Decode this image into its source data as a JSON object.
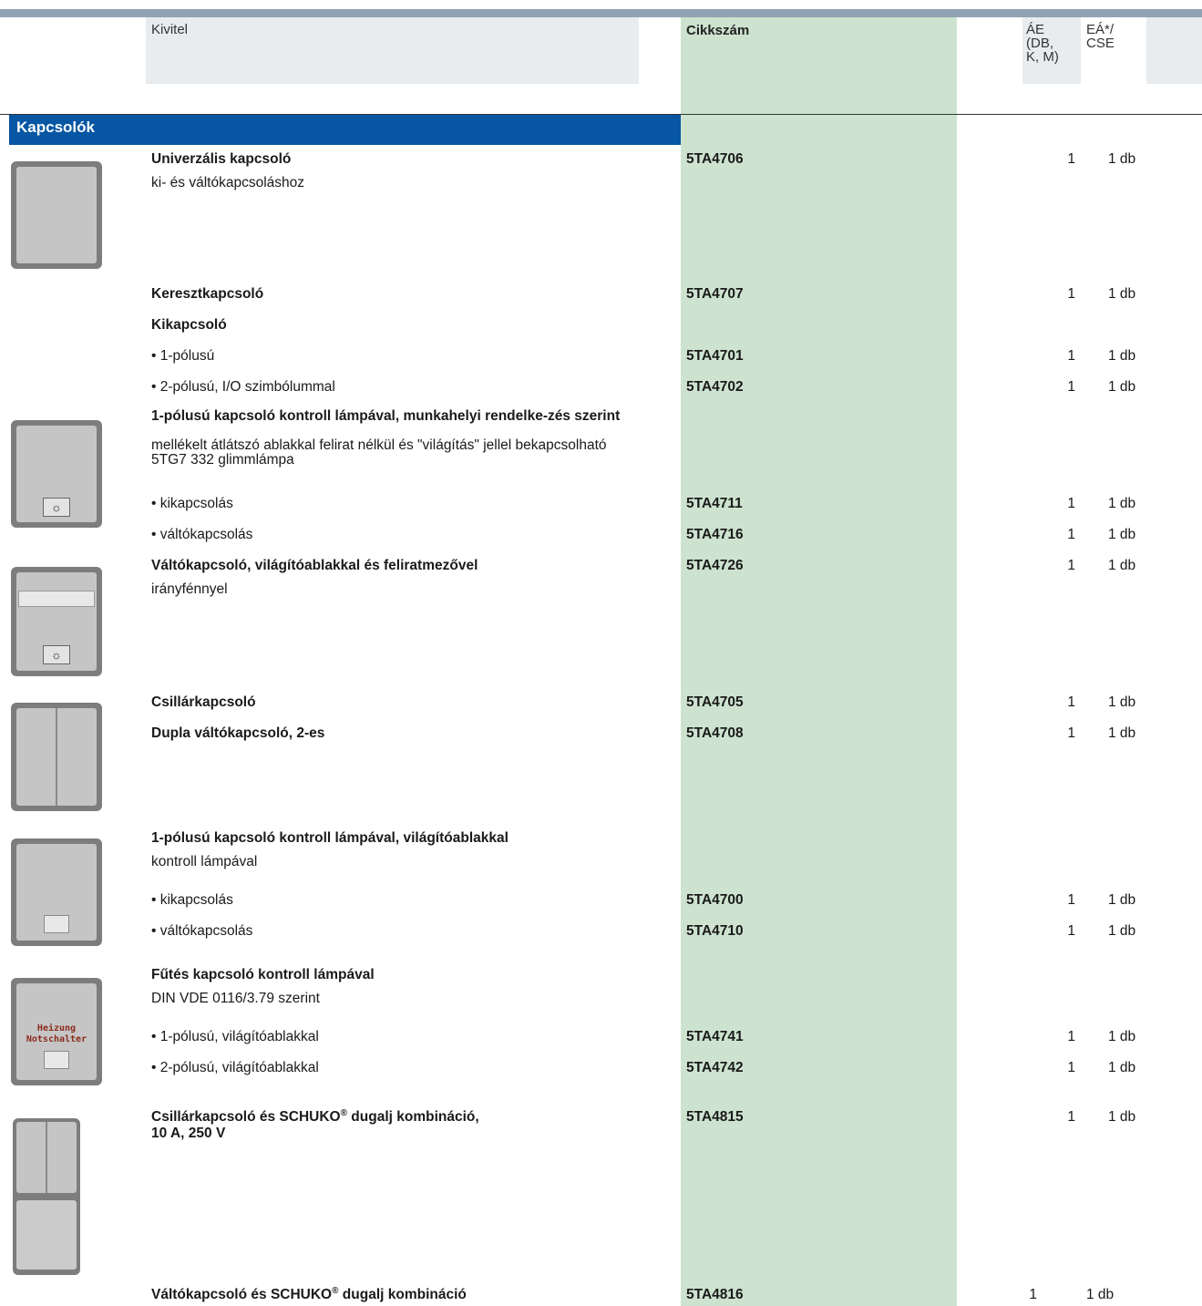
{
  "header": {
    "kivitel": "Kivitel",
    "cikkszam": "Cikkszám",
    "ae_lines": [
      "ÁE",
      "(DB,",
      "K, M)"
    ],
    "ea_lines": [
      "EÁ*/",
      "CSE"
    ]
  },
  "section_title": "Kapcsolók",
  "rows": [
    {
      "title": "Univerzális kapcsoló",
      "desc": "ki- és váltókapcsoláshoz",
      "code": "5TA4706",
      "ae": "1",
      "ea": "1 db"
    },
    {
      "title": "Keresztkapcsoló",
      "code": "5TA4707",
      "ae": "1",
      "ea": "1 db"
    },
    {
      "title": "Kikapcsoló"
    },
    {
      "text": "• 1-pólusú",
      "code": "5TA4701",
      "ae": "1",
      "ea": "1 db"
    },
    {
      "text": "• 2-pólusú, I/O szimbólummal",
      "code": "5TA4702",
      "ae": "1",
      "ea": "1 db"
    },
    {
      "title": "1-pólusú kapcsoló kontroll lámpával, munkahelyi rendelke-zés szerint",
      "desc": "mellékelt átlátszó ablakkal felirat nélkül és \"világítás\" jellel bekapcsolható 5TG7 332 glimmlámpa"
    },
    {
      "text": "• kikapcsolás",
      "code": "5TA4711",
      "ae": "1",
      "ea": "1 db"
    },
    {
      "text": "• váltókapcsolás",
      "code": "5TA4716",
      "ae": "1",
      "ea": "1 db"
    },
    {
      "title": "Váltókapcsoló, világítóablakkal és feliratmezővel",
      "desc": "irányfénnyel",
      "code": "5TA4726",
      "ae": "1",
      "ea": "1 db"
    },
    {
      "title": "Csillárkapcsoló",
      "code": "5TA4705",
      "ae": "1",
      "ea": "1 db"
    },
    {
      "title": "Dupla váltókapcsoló, 2-es",
      "code": "5TA4708",
      "ae": "1",
      "ea": "1 db"
    },
    {
      "title": "1-pólusú kapcsoló kontroll lámpával, világítóablakkal",
      "desc": "kontroll lámpával"
    },
    {
      "text": "•  kikapcsolás",
      "code": "5TA4700",
      "ae": "1",
      "ea": "1 db"
    },
    {
      "text": "• váltókapcsolás",
      "code": "5TA4710",
      "ae": "1",
      "ea": "1 db"
    },
    {
      "title": "Fűtés kapcsoló kontroll lámpával",
      "desc": "DIN VDE 0116/3.79 szerint"
    },
    {
      "text": "• 1-pólusú, világítóablakkal",
      "code": "5TA4741",
      "ae": "1",
      "ea": "1 db"
    },
    {
      "text": "• 2-pólusú, világítóablakkal",
      "code": "5TA4742",
      "ae": "1",
      "ea": "1 db"
    },
    {
      "title_a": "Csillárkapcsoló és SCHUKO",
      "sup": "®",
      "title_b": " dugalj kombináció,",
      "title_c": "10 A, 250 V",
      "code": "5TA4815",
      "ae": "1",
      "ea": "1 db"
    },
    {
      "title_a": "Váltókapcsoló és SCHUKO",
      "sup": "®",
      "title_b": " dugalj kombináció",
      "code": "5TA4816",
      "ae": "1",
      "ea": "1 db"
    }
  ],
  "icons": {
    "heizung_lines": [
      "Heizung",
      "Notschalter"
    ],
    "lamp_symbol": "☼"
  }
}
